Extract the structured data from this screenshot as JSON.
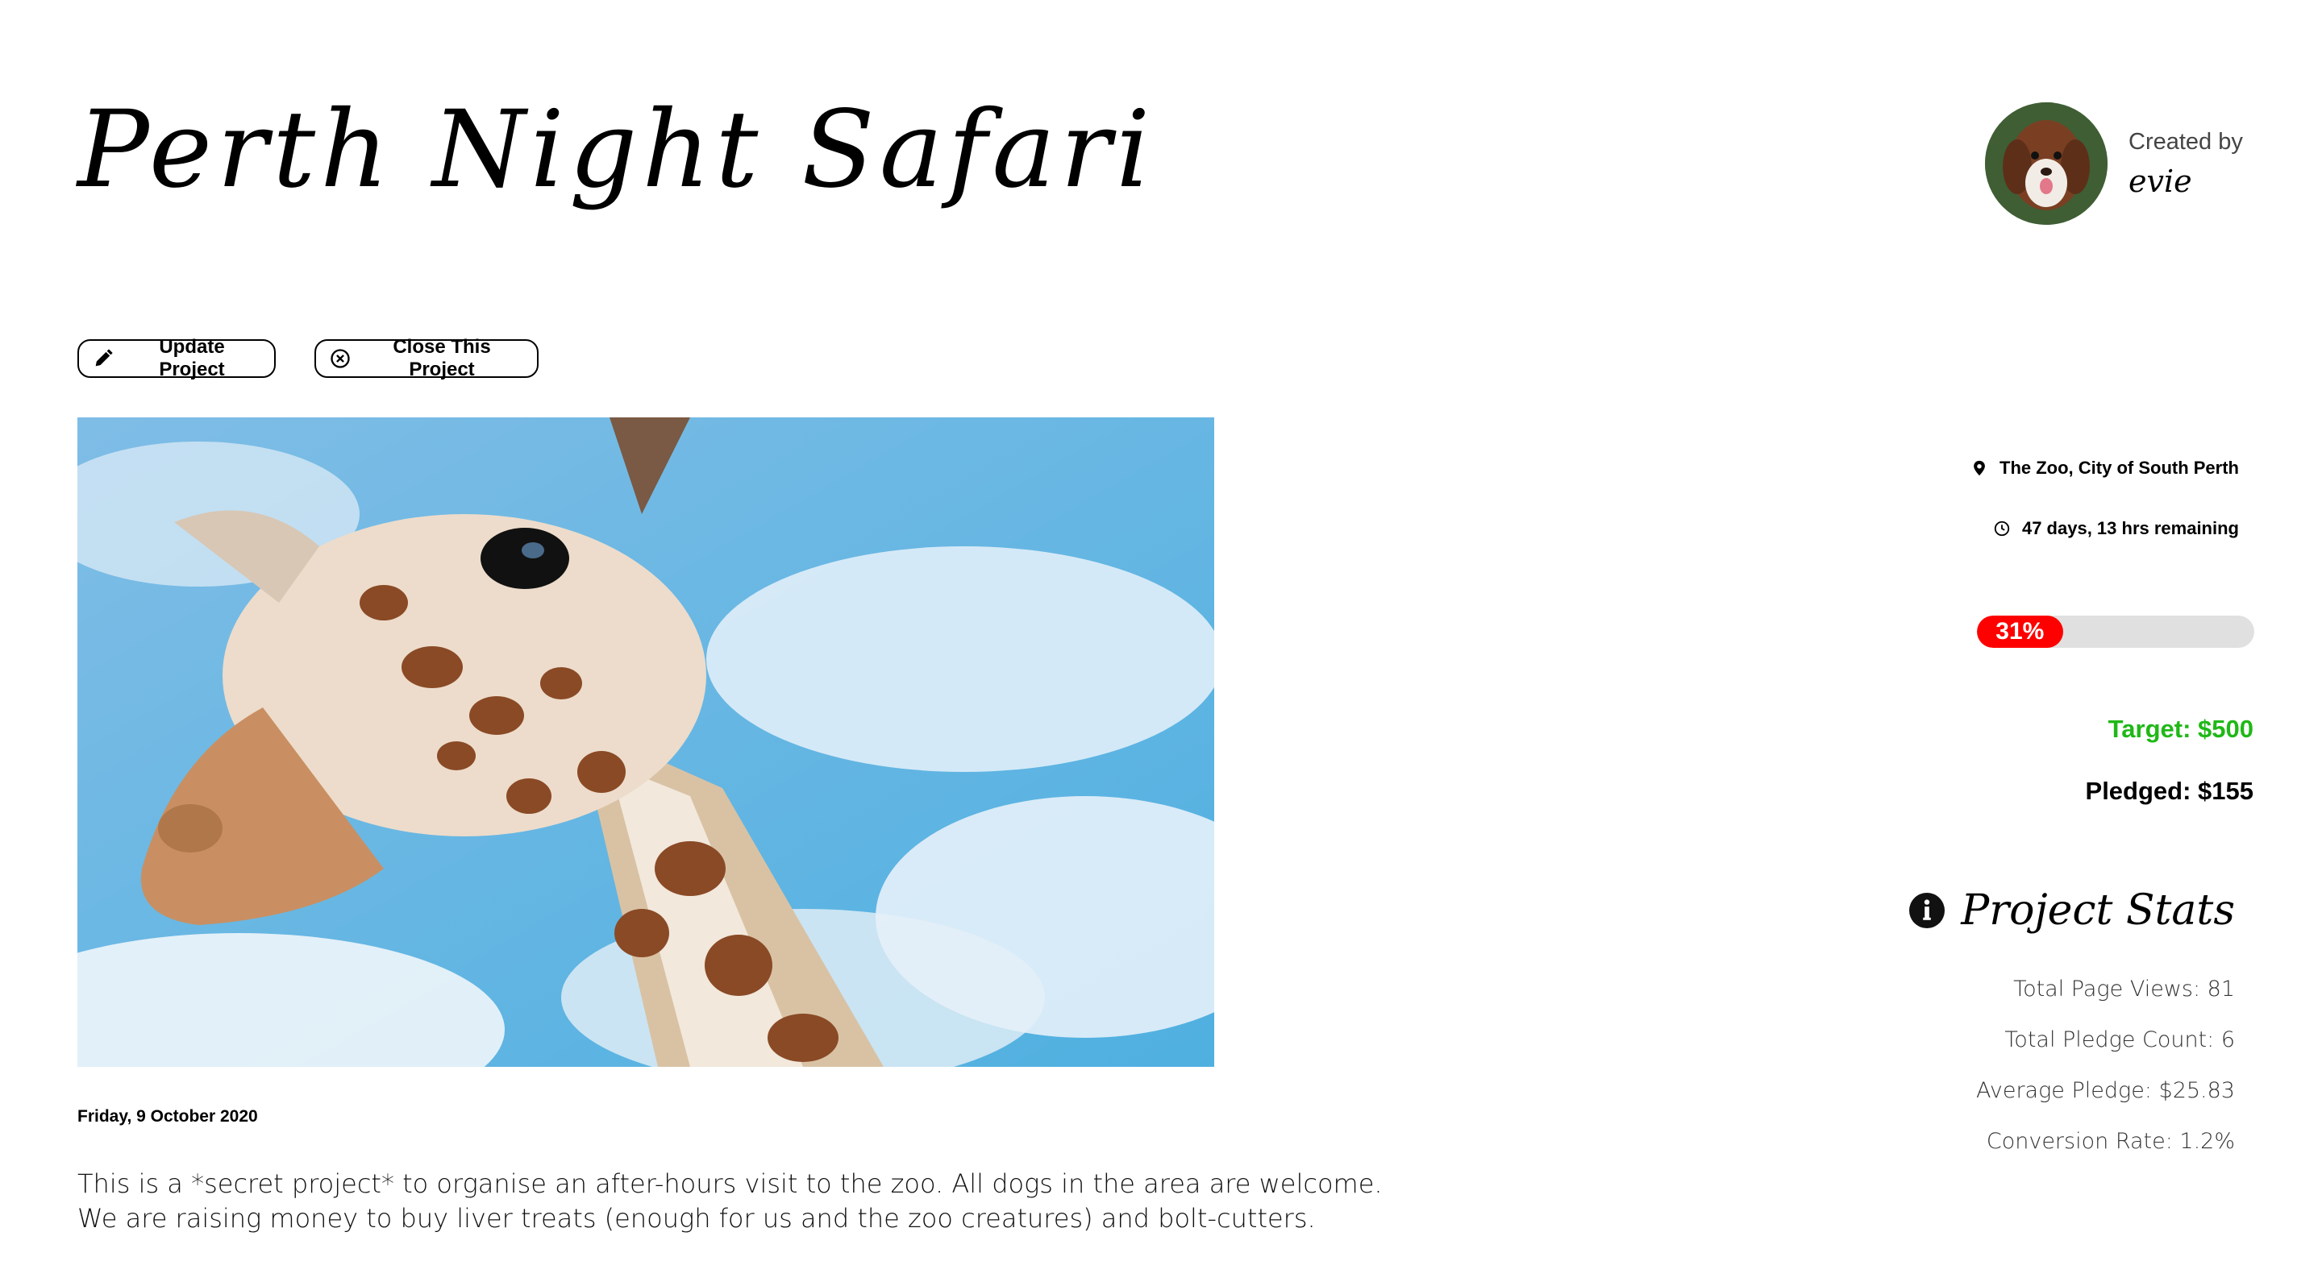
{
  "project": {
    "title": "Perth Night Safari",
    "date": "Friday, 9 October 2020",
    "description_line1": "This is a *secret project* to organise an after-hours visit to the zoo. All dogs in the area are welcome.",
    "description_line2": "We are raising money to buy liver treats (enough for us and the zoo creatures) and bolt-cutters.",
    "image_subject": "giraffe"
  },
  "creator": {
    "label": "Created by",
    "name": "evie"
  },
  "actions": {
    "update_label": "Update Project",
    "close_label": "Close This Project"
  },
  "sidebar": {
    "location": "The Zoo, City of South Perth",
    "time_remaining": "47 days, 13 hrs remaining",
    "progress_percent": 31,
    "progress_label": "31%",
    "target": "Target: $500",
    "pledged": "Pledged: $155"
  },
  "stats": {
    "title": "Project Stats",
    "items": [
      "Total Page Views: 81",
      "Total Pledge Count: 6",
      "Average Pledge: $25.83",
      "Conversion Rate: 1.2%"
    ]
  },
  "colors": {
    "progress_fill": "#ff0000",
    "progress_track": "#e0e0e0",
    "target_text": "#1fb816"
  },
  "icons": {
    "update": "pencil-icon",
    "close": "circle-x-icon",
    "location": "map-pin-icon",
    "time": "clock-icon",
    "stats": "info-circle-icon"
  }
}
